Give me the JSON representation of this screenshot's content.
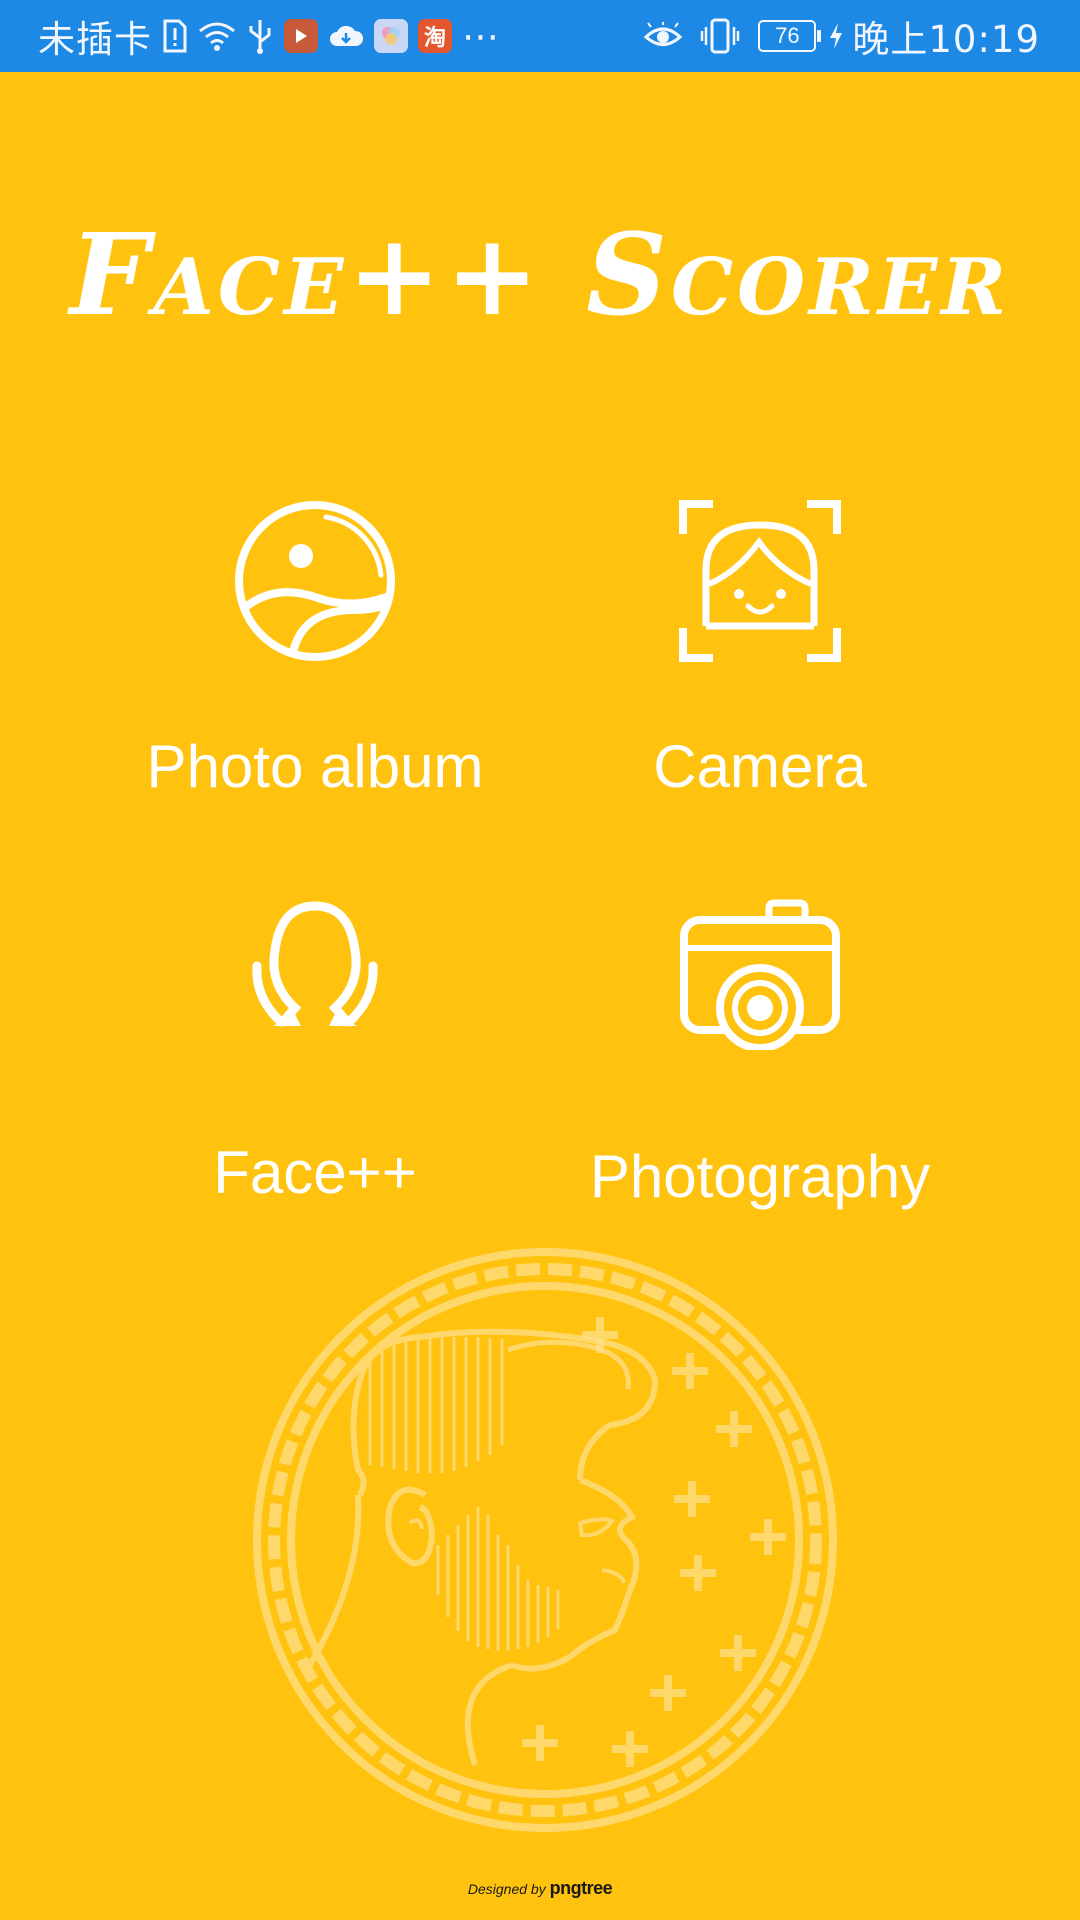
{
  "status_bar": {
    "carrier": "未插卡",
    "time": "晚上10:19",
    "battery_level": "76",
    "taobao_badge": "淘",
    "more_icon": "⋯",
    "colors": {
      "background": "#1E88E5",
      "foreground": "#F2F7FF"
    },
    "icons": [
      "sim-alert-icon",
      "wifi-icon",
      "usb-icon",
      "video-app-icon",
      "cloud-icon",
      "gallery-app-icon",
      "taobao-app-icon",
      "more-notifications-icon",
      "eye-comfort-icon",
      "vibrate-icon",
      "battery-icon",
      "charging-icon"
    ]
  },
  "app": {
    "title": "Face++ Scorer",
    "background_color": "#FFC20E"
  },
  "menu": {
    "photo_album": {
      "label": "Photo album",
      "icon": "photo-album-icon"
    },
    "camera": {
      "label": "Camera",
      "icon": "face-scan-icon"
    },
    "facepp": {
      "label": "Face++",
      "icon": "face-outline-icon"
    },
    "photography": {
      "label": "Photography",
      "icon": "camera-icon"
    }
  },
  "footer": {
    "designed_by": "Designed by",
    "brand": "pngtree"
  }
}
